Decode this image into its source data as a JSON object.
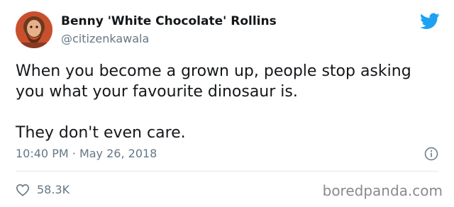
{
  "author": {
    "display_name": "Benny 'White Chocolate' Rollins",
    "handle": "@citizenkawala"
  },
  "tweet": {
    "line1": "When you become a grown up, people stop asking you what your favourite dinosaur is.",
    "line2": "They don't even care.",
    "time": "10:40 PM",
    "separator": "·",
    "date": "May 26, 2018"
  },
  "stats": {
    "likes": "58.3K"
  },
  "watermark": "boredpanda.com",
  "icons": {
    "brand": "twitter-bird-icon",
    "info": "info-icon",
    "like": "heart-icon"
  },
  "colors": {
    "twitter_blue": "#1da1f2",
    "text": "#14171a",
    "muted": "#657786"
  }
}
